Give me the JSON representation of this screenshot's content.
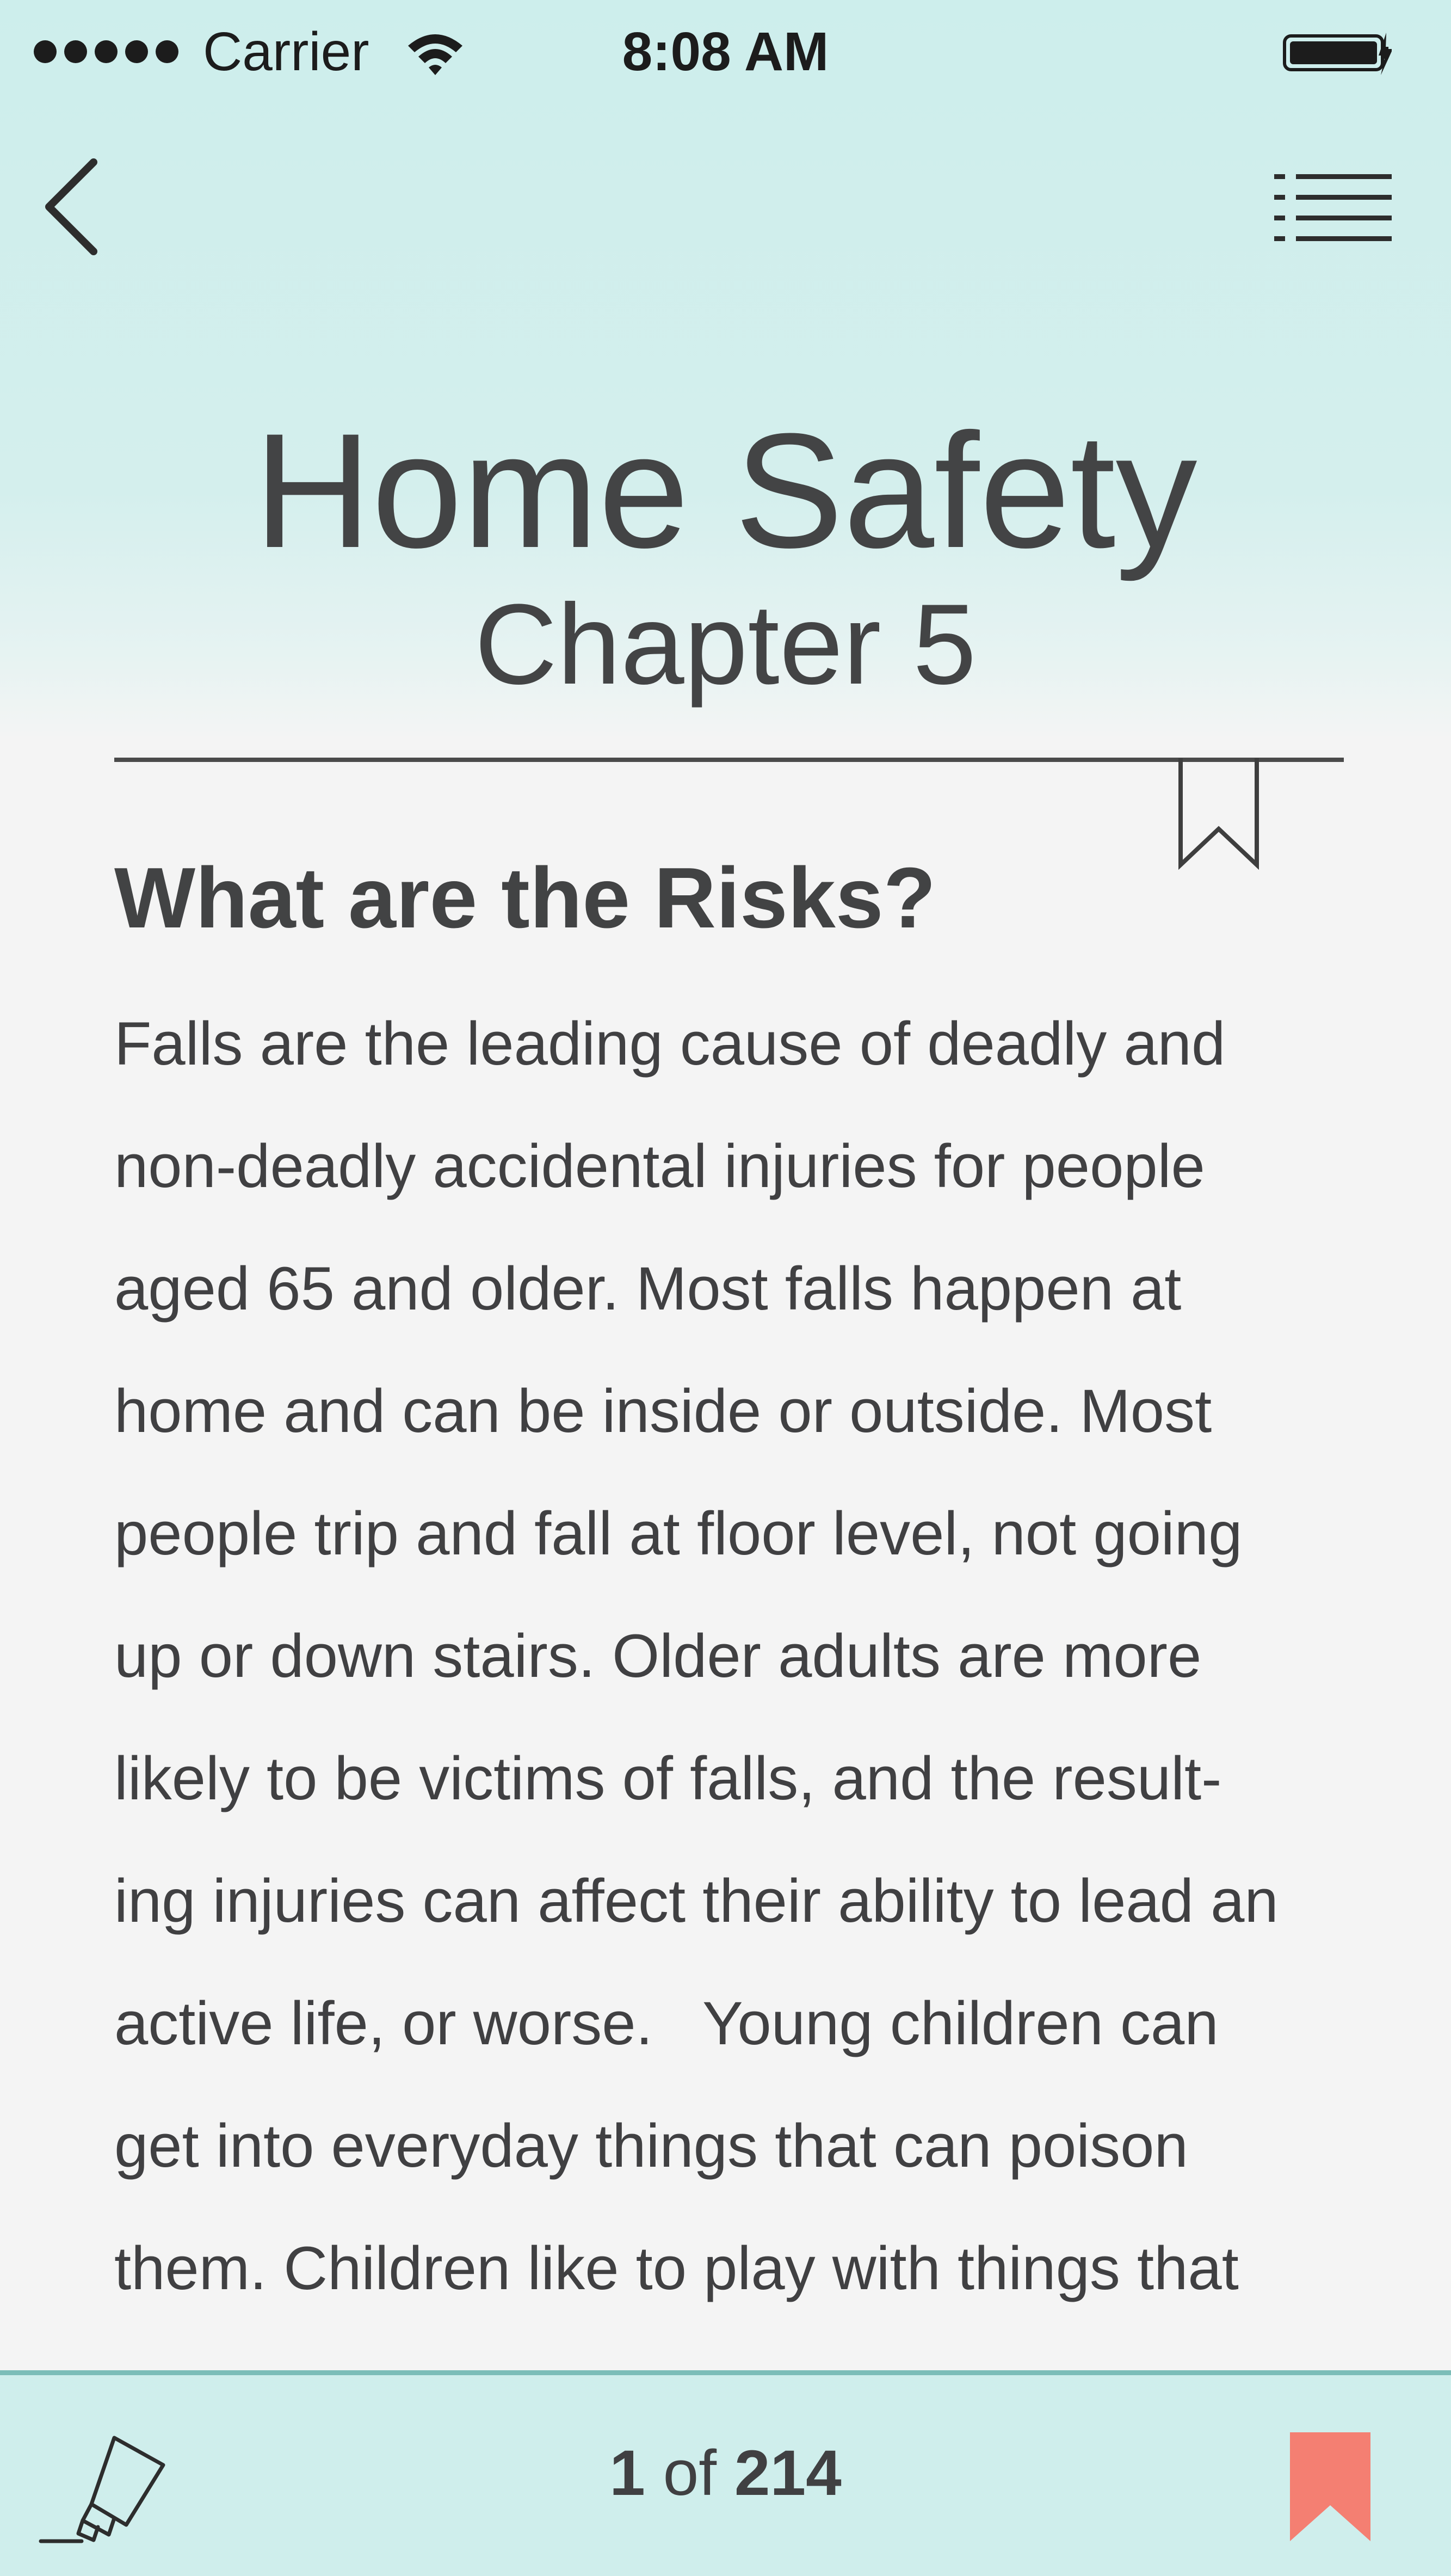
{
  "status_bar": {
    "carrier": "Carrier",
    "time": "8:08 AM",
    "signal_icon": "signal-dots-icon",
    "wifi_icon": "wifi-icon",
    "battery_icon": "battery-charging-icon"
  },
  "nav": {
    "back_icon": "chevron-left-icon",
    "menu_icon": "list-icon"
  },
  "header": {
    "title": "Home Safety",
    "subtitle": "Chapter 5"
  },
  "content": {
    "heading": "What are the Risks?",
    "lines": [
      "Falls are the leading cause of deadly and",
      "non-deadly accidental injuries for people",
      "aged 65 and older. Most falls happen at",
      "home and can be inside or outside. Most",
      "people trip and fall at floor level, not going",
      "up or down stairs. Older adults are more",
      "likely to be victims of falls, and the result-",
      "ing injuries can affect their ability to lead an",
      "active life, or worse.   Young children can",
      "get into everyday things that can poison",
      "them. Children like to play with things that"
    ],
    "bookmark_icon": "bookmark-outline-icon"
  },
  "footer": {
    "current_page": "1",
    "of_label": "of",
    "total_pages": "214",
    "highlighter_icon": "highlighter-icon",
    "bookmark_icon": "bookmark-filled-icon",
    "bookmark_color": "#f47f72"
  },
  "colors": {
    "header_bg": "#cdeeec",
    "page_bg": "#f4f4f4",
    "text": "#404042",
    "bottom_bar_border": "#7cbdb8"
  }
}
